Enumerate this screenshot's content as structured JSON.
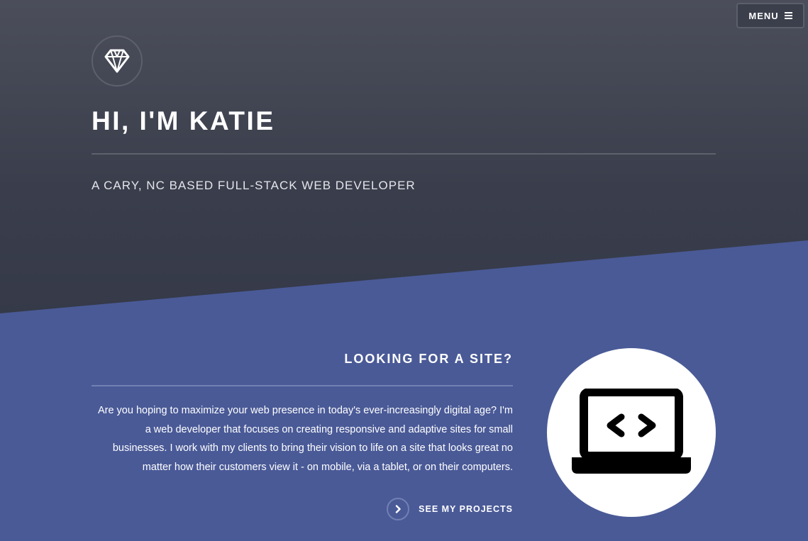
{
  "nav": {
    "menu_label": "MENU",
    "menu_icon": "hamburger-icon"
  },
  "hero": {
    "logo_icon": "diamond-icon",
    "title": "HI, I'M KATIE",
    "subtitle": "A CARY, NC BASED FULL-STACK WEB DEVELOPER"
  },
  "about": {
    "heading": "LOOKING FOR A SITE?",
    "body": "Are you hoping to maximize your web presence in today's ever-increasingly digital age? I'm a web developer that focuses on creating responsive and adaptive sites for small businesses. I work with my clients to bring their vision to life on a site that looks great no matter how their customers view it - on mobile, via a tablet, or on their computers.",
    "cta_label": "SEE MY PROJECTS",
    "cta_icon": "chevron-right-icon",
    "illustration_icon": "laptop-code-icon"
  },
  "colors": {
    "hero_bg_top": "#4b4e5a",
    "hero_bg_bottom": "#2c3142",
    "section_bg": "#4a5a97",
    "text": "#ffffff"
  }
}
